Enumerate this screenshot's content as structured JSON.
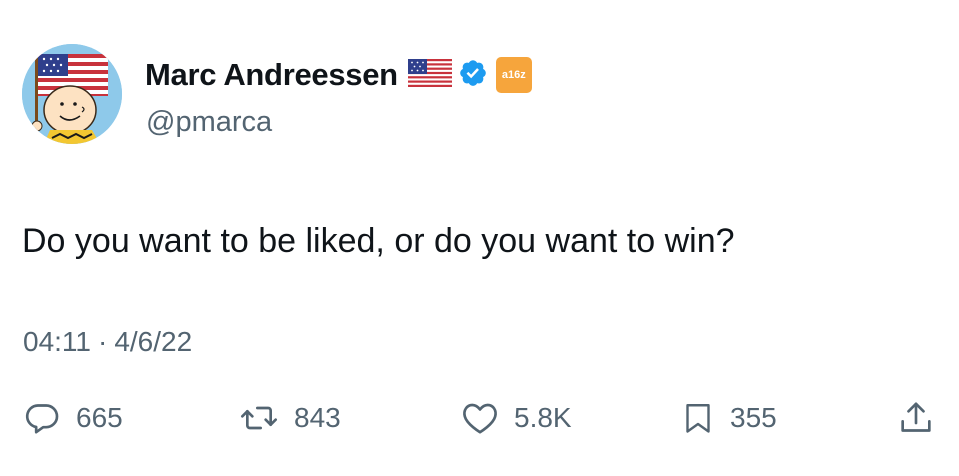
{
  "author": {
    "display_name": "Marc Andreessen",
    "handle": "@pmarca",
    "affiliate_badge_text": "a16z",
    "flag_icon": "us-flag-icon",
    "verified_icon": "verified-checkmark-icon",
    "verified_color": "#1d9bf0",
    "affiliate_color": "#f6a53c"
  },
  "tweet": {
    "text": "Do you want to be liked, or do you want to win?",
    "time": "04:11",
    "separator": "·",
    "date": "4/6/22"
  },
  "actions": {
    "replies": {
      "icon": "reply-icon",
      "count": "665"
    },
    "reposts": {
      "icon": "repost-icon",
      "count": "843"
    },
    "likes": {
      "icon": "heart-icon",
      "count": "5.8K"
    },
    "bookmarks": {
      "icon": "bookmark-icon",
      "count": "355"
    },
    "share": {
      "icon": "share-icon"
    }
  },
  "colors": {
    "text_primary": "#0f1419",
    "text_secondary": "#536471",
    "background": "#ffffff"
  }
}
